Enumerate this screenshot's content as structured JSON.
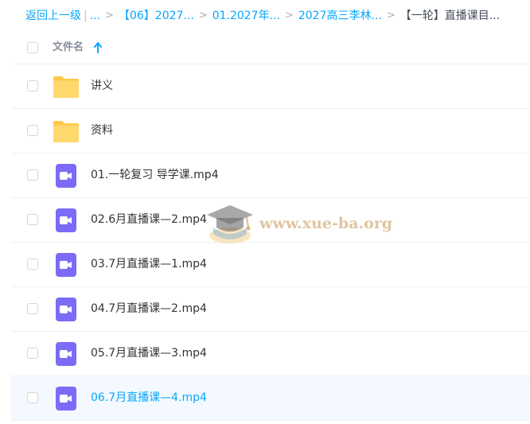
{
  "breadcrumb": {
    "back": "返回上一级",
    "pipe": "|",
    "ellipsis": "...",
    "items": [
      "【06】2027...",
      "01.2027年...",
      "2027高三李林..."
    ],
    "current": "【一轮】直播课目..."
  },
  "header": {
    "name_label": "文件名"
  },
  "files": [
    {
      "name": "讲义",
      "type": "folder"
    },
    {
      "name": "资料",
      "type": "folder"
    },
    {
      "name": "01.一轮复习 导学课.mp4",
      "type": "video"
    },
    {
      "name": "02.6月直播课—2.mp4",
      "type": "video"
    },
    {
      "name": "03.7月直播课—1.mp4",
      "type": "video"
    },
    {
      "name": "04.7月直播课—2.mp4",
      "type": "video"
    },
    {
      "name": "05.7月直播课—3.mp4",
      "type": "video"
    },
    {
      "name": "06.7月直播课—4.mp4",
      "type": "video"
    }
  ],
  "watermark": {
    "text": "www.xue-ba.org"
  },
  "colors": {
    "accent": "#06a7ff",
    "folder": "#ffd25f",
    "video": "#7b6bf6",
    "hover_row": "#f3f9ff"
  },
  "icons": {
    "sort": "arrow-up-icon",
    "folder": "folder-icon",
    "video": "video-file-icon",
    "watermark": "graduation-cap-logo"
  }
}
